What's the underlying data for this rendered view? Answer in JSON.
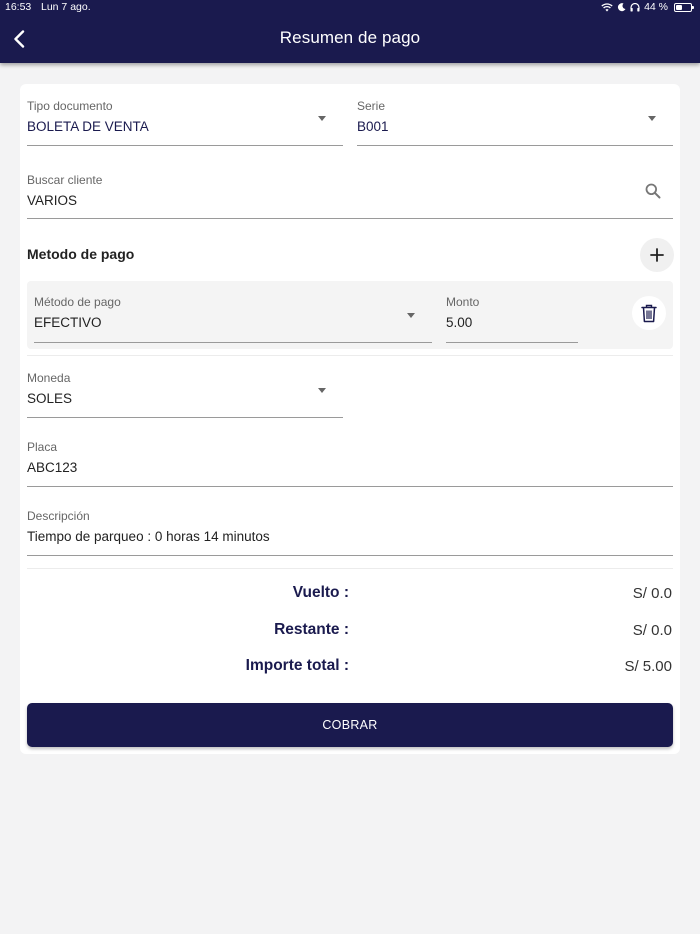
{
  "status_bar": {
    "time": "16:53",
    "date": "Lun 7 ago.",
    "battery": "44 %",
    "battery_level": 0.44
  },
  "header": {
    "title": "Resumen de pago",
    "back_icon": "chevron-left-icon"
  },
  "form": {
    "tipo_documento": {
      "label": "Tipo documento",
      "value": "BOLETA DE VENTA"
    },
    "serie": {
      "label": "Serie",
      "value": "B001"
    },
    "buscar_cliente": {
      "label": "Buscar cliente",
      "value": "VARIOS",
      "icon": "search-icon"
    },
    "metodo_pago_section": {
      "title": "Metodo de pago",
      "add_icon": "plus-icon"
    },
    "payment_rows": [
      {
        "method_label": "Método de pago",
        "method_value": "EFECTIVO",
        "amount_label": "Monto",
        "amount_value": "5.00",
        "delete_icon": "trash-icon"
      }
    ],
    "moneda": {
      "label": "Moneda",
      "value": "SOLES"
    },
    "placa": {
      "label": "Placa",
      "value": "ABC123"
    },
    "descripcion": {
      "label": "Descripción",
      "value": "Tiempo de parqueo : 0 horas 14 minutos"
    }
  },
  "summary": {
    "vuelto": {
      "label": "Vuelto :",
      "value": "S/ 0.0"
    },
    "restante": {
      "label": "Restante :",
      "value": "S/ 0.0"
    },
    "importe_total": {
      "label": "Importe total :",
      "value": "S/ 5.00"
    }
  },
  "actions": {
    "cobrar_label": "COBRAR"
  },
  "colors": {
    "primary": "#1a1a4e",
    "background": "#f3f3f4",
    "card": "#ffffff"
  }
}
